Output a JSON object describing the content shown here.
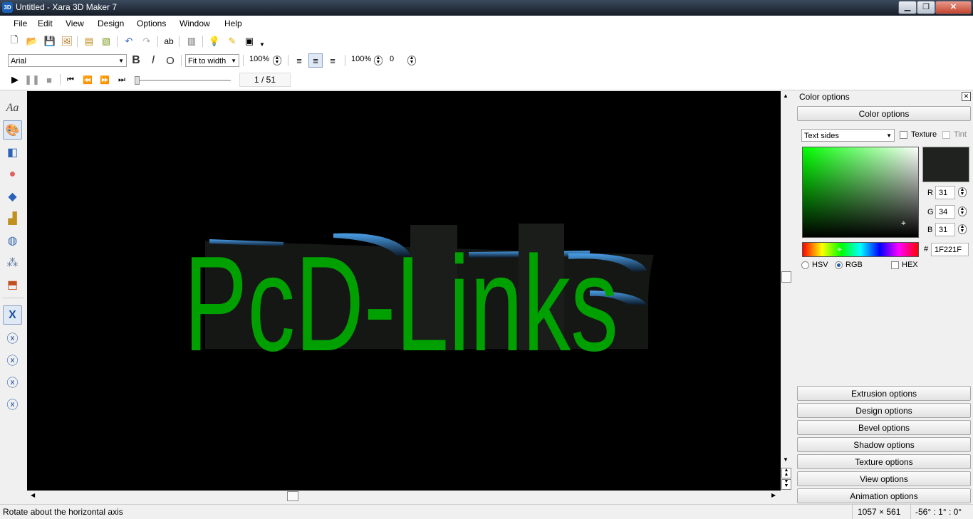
{
  "window": {
    "title": "Untitled - Xara 3D Maker 7",
    "app_icon": "3D"
  },
  "menu": [
    "File",
    "Edit",
    "View",
    "Design",
    "Options",
    "Window",
    "Help"
  ],
  "toolbar": {
    "font": "Arial",
    "fit_mode": "Fit to width",
    "zoom": "100%",
    "spacing": "100%",
    "offset": "0",
    "frame_counter": "1 / 51"
  },
  "canvas": {
    "text": "PcD-Links",
    "text_color": "#00a000",
    "background": "#000000"
  },
  "panel": {
    "title": "Color options",
    "header_button": "Color options",
    "target": "Text sides",
    "texture_label": "Texture",
    "tint_label": "Tint",
    "swatch": "#1F221F",
    "r_label": "R",
    "r_value": "31",
    "g_label": "G",
    "g_value": "34",
    "b_label": "B",
    "b_value": "31",
    "hash": "#",
    "hex_value": "1F221F",
    "hsv_label": "HSV",
    "rgb_label": "RGB",
    "hex_label": "HEX",
    "sections": [
      "Extrusion options",
      "Design options",
      "Bevel options",
      "Shadow options",
      "Texture options",
      "View options",
      "Animation options"
    ]
  },
  "status": {
    "message": "Rotate about the horizontal axis",
    "size": "1057 × 561",
    "rotation": "-56° : 1° : 0°"
  }
}
